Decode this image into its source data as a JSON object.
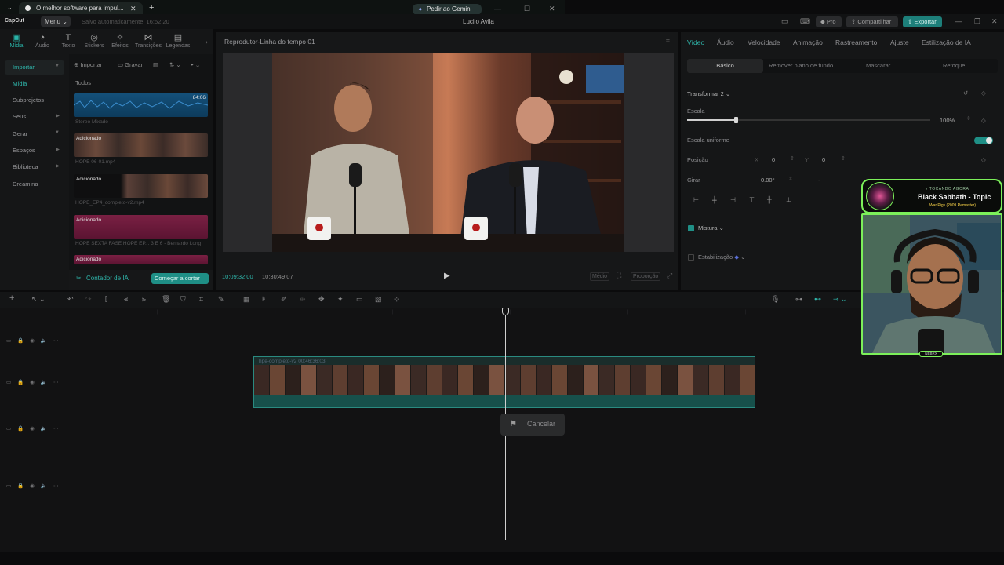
{
  "browser": {
    "tab_title": "O melhor software para impul...",
    "gemini_label": "Pedir ao Gemini"
  },
  "app": {
    "logo": "CapCut",
    "menu_label": "Menu",
    "autosave": "Salvo automaticamente: 16:52:20",
    "project_title": "Lucilo Avila",
    "pro_label": "Pro",
    "share_label": "Compartilhar",
    "export_label": "Exportar"
  },
  "tools": [
    {
      "label": "Mídia",
      "icon": "media-icon"
    },
    {
      "label": "Áudio",
      "icon": "audio-icon"
    },
    {
      "label": "Texto",
      "icon": "text-icon"
    },
    {
      "label": "Stickers",
      "icon": "sticker-icon"
    },
    {
      "label": "Efeitos",
      "icon": "effects-icon"
    },
    {
      "label": "Transições",
      "icon": "transitions-icon"
    },
    {
      "label": "Legendas",
      "icon": "captions-icon"
    }
  ],
  "left_nav": [
    {
      "label": "Importar",
      "active": true
    },
    {
      "label": "Mídia"
    },
    {
      "label": "Subprojetos"
    },
    {
      "label": "Seus"
    },
    {
      "label": "Gerar"
    },
    {
      "label": "Espaços"
    },
    {
      "label": "Biblioteca"
    },
    {
      "label": "Dreamina"
    }
  ],
  "media": {
    "import_label": "Importar",
    "record_label": "Gravar",
    "filter_label": "Todos",
    "clips": [
      {
        "tag": "",
        "duration": "84:06",
        "caption": "Stereo Mixado"
      },
      {
        "tag": "Adicionado",
        "caption": "HOPE 06-01.mp4"
      },
      {
        "tag": "Adicionado",
        "caption": "HOPE_EP4_completo-v2.mp4"
      },
      {
        "tag": "Adicionado",
        "caption": "HOPE SEXTA FASE HOPE EP... 3 E 6 - Bernardo Long"
      },
      {
        "tag": "Adicionado",
        "caption": ""
      }
    ],
    "ai_counter_label": "Contador de IA",
    "start_cut_label": "Começar a cortar"
  },
  "player": {
    "title": "Reprodutor-Linha do tempo 01",
    "timecode_current": "10:09:32:00",
    "timecode_total": "10:30:49:07",
    "quality_label": "Médio",
    "ratio_label": "Proporção"
  },
  "props": {
    "tabs": [
      "Vídeo",
      "Áudio",
      "Velocidade",
      "Animação",
      "Rastreamento",
      "Ajuste",
      "Estilização de IA"
    ],
    "subtabs": [
      "Básico",
      "Remover plano de fundo",
      "Mascarar",
      "Retoque"
    ],
    "transform_label": "Transformar 2",
    "scale_label": "Escala",
    "scale_value": "100%",
    "scale_fraction": 0.2,
    "uniform_label": "Escala uniforme",
    "position_label": "Posição",
    "pos_x_label": "X",
    "pos_x": "0",
    "pos_y_label": "Y",
    "pos_y": "0",
    "rotate_label": "Girar",
    "rotate_value": "0.00°",
    "mix_label": "Mistura",
    "stab_label": "Estabilização"
  },
  "timeline": {
    "clip_title": "hpe-completo-v2  00:46:36:03",
    "cancel_label": "Cancelar"
  },
  "now_playing": {
    "status": "♪ TOCANDO AGORA",
    "track": "Black Sabbath - Topic",
    "album": "War Pigs (2009 Remaster)"
  },
  "webcam": {
    "tag": "NEBRX"
  },
  "colors": {
    "accent": "#2fb8ad",
    "export": "#1d7f7a",
    "overlay_border": "#7cf05a"
  }
}
